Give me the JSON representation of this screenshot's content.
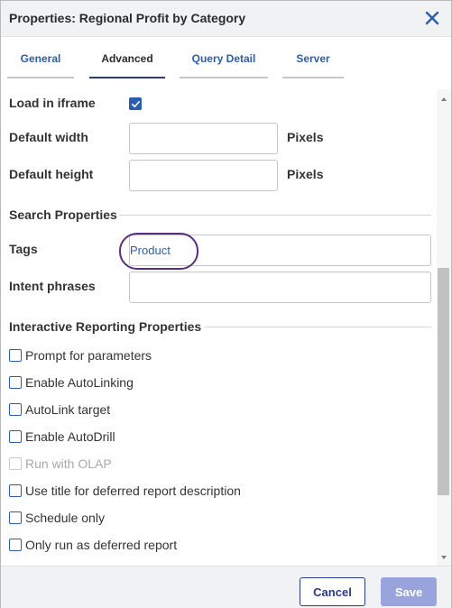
{
  "window": {
    "title": "Properties: Regional Profit by Category",
    "close_icon": "close-icon"
  },
  "tabs": [
    {
      "label": "General",
      "active": false
    },
    {
      "label": "Advanced",
      "active": true
    },
    {
      "label": "Query Detail",
      "active": false
    },
    {
      "label": "Server",
      "active": false
    }
  ],
  "form": {
    "load_in_iframe": {
      "label": "Load in iframe",
      "checked": true
    },
    "default_width": {
      "label": "Default width",
      "value": "",
      "unit": "Pixels"
    },
    "default_height": {
      "label": "Default height",
      "value": "",
      "unit": "Pixels"
    },
    "search_section": "Search Properties",
    "tags": {
      "label": "Tags",
      "value": "Product"
    },
    "intent_phrases": {
      "label": "Intent phrases",
      "value": ""
    },
    "interactive_section": "Interactive Reporting Properties",
    "options": [
      {
        "label": "Prompt for parameters",
        "checked": false,
        "disabled": false
      },
      {
        "label": "Enable AutoLinking",
        "checked": false,
        "disabled": false
      },
      {
        "label": "AutoLink target",
        "checked": false,
        "disabled": false
      },
      {
        "label": "Enable AutoDrill",
        "checked": false,
        "disabled": false
      },
      {
        "label": "Run with OLAP",
        "checked": false,
        "disabled": true
      },
      {
        "label": "Use title for deferred report description",
        "checked": false,
        "disabled": false
      },
      {
        "label": "Schedule only",
        "checked": false,
        "disabled": false
      },
      {
        "label": "Only run as deferred report",
        "checked": false,
        "disabled": false
      }
    ]
  },
  "footer": {
    "cancel_label": "Cancel",
    "save_label": "Save"
  },
  "colors": {
    "accent": "#2a5db0",
    "brand_dark": "#2a3a8c",
    "highlight_ring": "#5b2d82",
    "save_disabled": "#9aa4dc"
  }
}
